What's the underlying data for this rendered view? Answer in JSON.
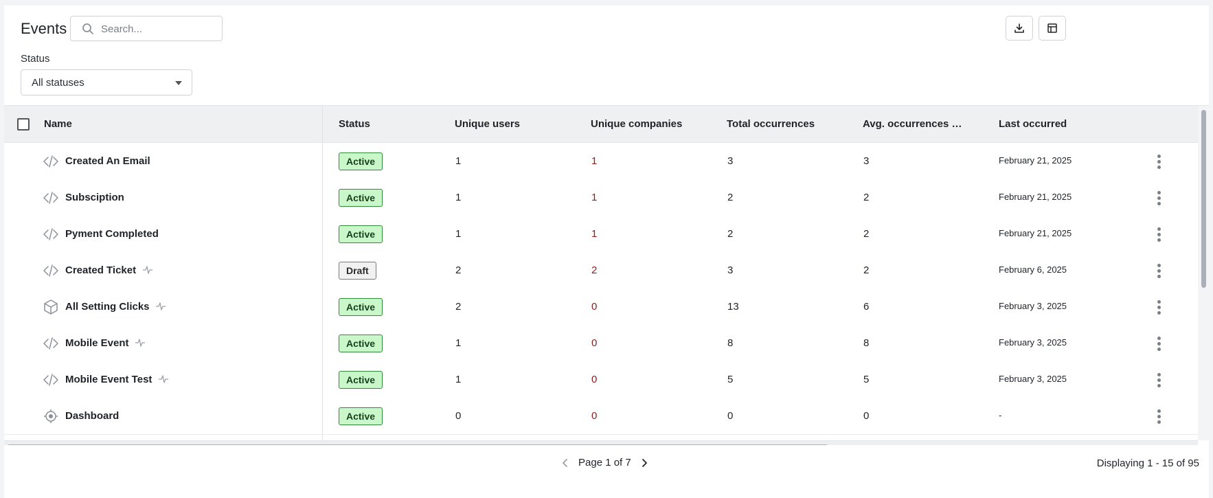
{
  "header": {
    "title": "Events",
    "search_placeholder": "Search...",
    "download_button": "download-icon",
    "columns_button": "table-layout-icon"
  },
  "filters": {
    "status_label": "Status",
    "status_value": "All statuses"
  },
  "table": {
    "columns": [
      "Name",
      "Status",
      "Unique users",
      "Unique companies",
      "Total occurrences",
      "Avg. occurrences pe...",
      "Last occurred"
    ],
    "rows": [
      {
        "icon": "code-icon",
        "name": "Created An Email",
        "activity": false,
        "status": "Active",
        "unique_users": "1",
        "unique_companies": "1",
        "total_occurrences": "3",
        "avg_occurrences": "3",
        "last_occurred": "February 21, 2025"
      },
      {
        "icon": "code-icon",
        "name": "Subsciption",
        "activity": false,
        "status": "Active",
        "unique_users": "1",
        "unique_companies": "1",
        "total_occurrences": "2",
        "avg_occurrences": "2",
        "last_occurred": "February 21, 2025"
      },
      {
        "icon": "code-icon",
        "name": "Pyment Completed",
        "activity": false,
        "status": "Active",
        "unique_users": "1",
        "unique_companies": "1",
        "total_occurrences": "2",
        "avg_occurrences": "2",
        "last_occurred": "February 21, 2025"
      },
      {
        "icon": "code-icon",
        "name": "Created Ticket",
        "activity": true,
        "status": "Draft",
        "unique_users": "2",
        "unique_companies": "2",
        "total_occurrences": "3",
        "avg_occurrences": "2",
        "last_occurred": "February 6, 2025"
      },
      {
        "icon": "cube-icon",
        "name": "All Setting Clicks",
        "activity": true,
        "status": "Active",
        "unique_users": "2",
        "unique_companies": "0",
        "total_occurrences": "13",
        "avg_occurrences": "6",
        "last_occurred": "February 3, 2025"
      },
      {
        "icon": "code-icon",
        "name": "Mobile Event",
        "activity": true,
        "status": "Active",
        "unique_users": "1",
        "unique_companies": "0",
        "total_occurrences": "8",
        "avg_occurrences": "8",
        "last_occurred": "February 3, 2025"
      },
      {
        "icon": "code-icon",
        "name": "Mobile Event Test",
        "activity": true,
        "status": "Active",
        "unique_users": "1",
        "unique_companies": "0",
        "total_occurrences": "5",
        "avg_occurrences": "5",
        "last_occurred": "February 3, 2025"
      },
      {
        "icon": "target-icon",
        "name": "Dashboard",
        "activity": false,
        "status": "Active",
        "unique_users": "0",
        "unique_companies": "0",
        "total_occurrences": "0",
        "avg_occurrences": "0",
        "last_occurred": "-"
      }
    ]
  },
  "footer": {
    "page_text": "Page 1 of 7",
    "displaying_text": "Displaying 1 - 15 of 95"
  },
  "colors": {
    "active_bg": "#c9f7c9",
    "active_border": "#2f8a3a",
    "draft_bg": "#f1f1f1",
    "header_bg": "#eef0f2",
    "company_count_color": "#8b1c1c"
  }
}
